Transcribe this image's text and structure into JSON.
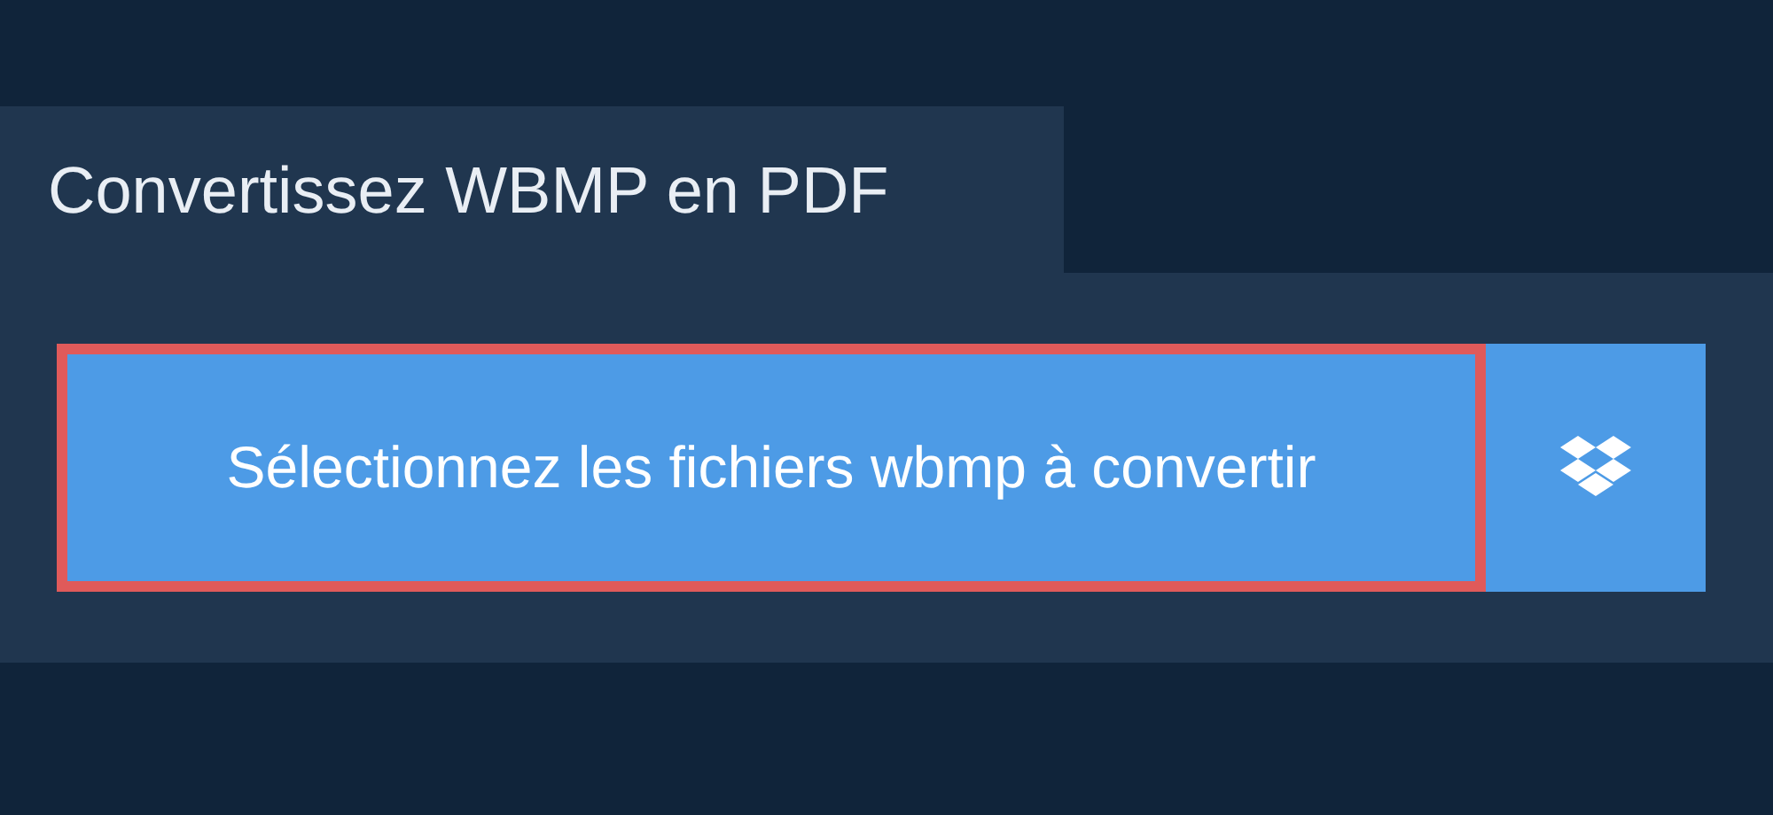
{
  "title": "Convertissez WBMP en PDF",
  "select_button": {
    "label": "Sélectionnez les fichiers wbmp à convertir",
    "focused": true
  }
}
